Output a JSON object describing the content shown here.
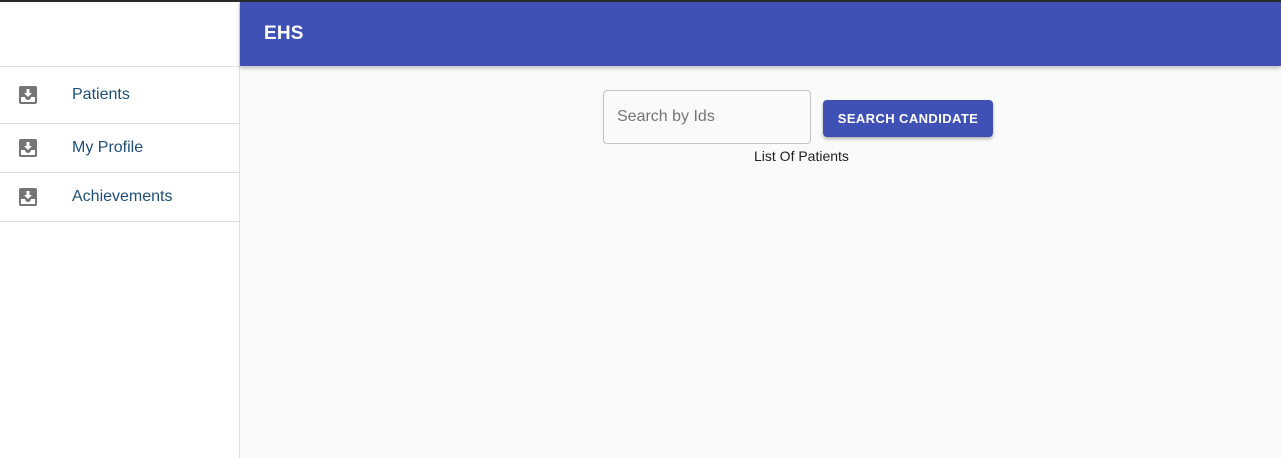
{
  "app": {
    "title": "EHS"
  },
  "sidebar": {
    "items": [
      {
        "label": "Patients",
        "icon": "inbox-download-icon"
      },
      {
        "label": "My Profile",
        "icon": "inbox-download-icon"
      },
      {
        "label": "Achievements",
        "icon": "inbox-download-icon"
      }
    ]
  },
  "search": {
    "placeholder": "Search by Ids",
    "value": "",
    "button_label": "SEARCH CANDIDATE"
  },
  "main": {
    "caption": "List Of Patients"
  },
  "colors": {
    "primary": "#3f51b5",
    "nav_text": "#1d4f7a",
    "icon": "#757575",
    "background": "#fafafa"
  }
}
